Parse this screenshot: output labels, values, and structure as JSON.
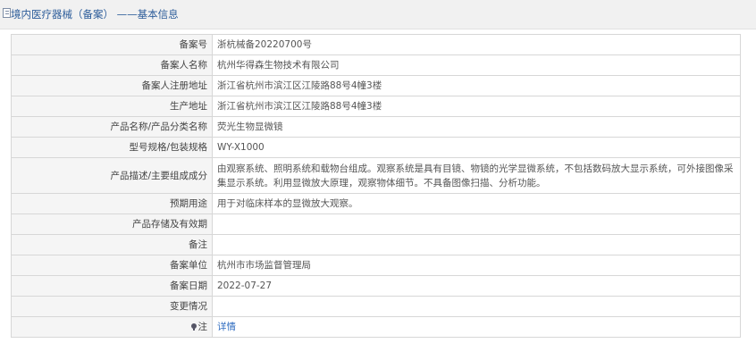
{
  "header": {
    "title": "境内医疗器械（备案） ——基本信息"
  },
  "rows": [
    {
      "label": "备案号",
      "value": "浙杭械备20220700号"
    },
    {
      "label": "备案人名称",
      "value": "杭州华得森生物技术有限公司"
    },
    {
      "label": "备案人注册地址",
      "value": "浙江省杭州市滨江区江陵路88号4幢3楼"
    },
    {
      "label": "生产地址",
      "value": "浙江省杭州市滨江区江陵路88号4幢3楼"
    },
    {
      "label": "产品名称/产品分类名称",
      "value": "荧光生物显微镜"
    },
    {
      "label": "型号规格/包装规格",
      "value": "WY-X1000"
    },
    {
      "label": "产品描述/主要组成成分",
      "value": "由观察系统、照明系统和载物台组成。观察系统是具有目镜、物镜的光学显微系统，不包括数码放大显示系统，可外接图像采集显示系统。利用显微放大原理，观察物体细节。不具备图像扫描、分析功能。"
    },
    {
      "label": "预期用途",
      "value": "用于对临床样本的显微放大观察。"
    },
    {
      "label": "产品存储及有效期",
      "value": ""
    },
    {
      "label": "备注",
      "value": ""
    },
    {
      "label": "备案单位",
      "value": "杭州市市场监督管理局"
    },
    {
      "label": "备案日期",
      "value": "2022-07-27"
    },
    {
      "label": "变更情况",
      "value": ""
    }
  ],
  "note_row": {
    "icon": "pin-icon",
    "label": "注",
    "link_text": "详情"
  },
  "colors": {
    "title": "#2d5d9a",
    "link": "#2f6cc0",
    "label_bg": "#f5f5f5",
    "border": "#d7d7d7"
  }
}
